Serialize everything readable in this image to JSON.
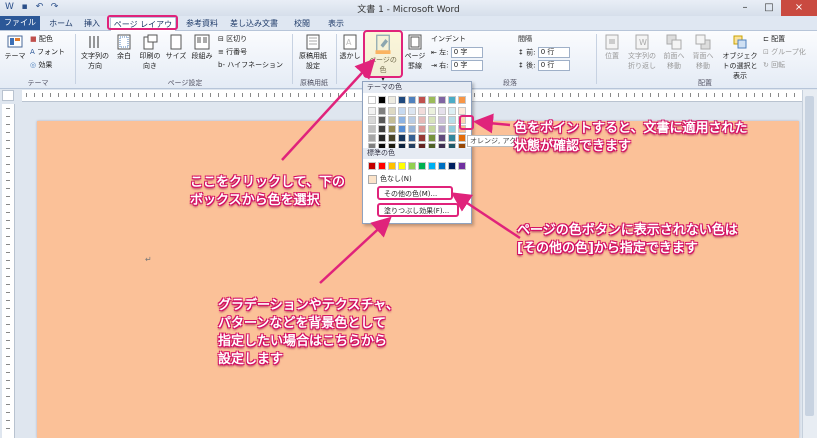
{
  "window": {
    "title": "文書 1 - Microsoft Word"
  },
  "tabs": [
    "ファイル",
    "ホーム",
    "挿入",
    "ページ レイアウト",
    "参考資料",
    "差し込み文書",
    "校閲",
    "表示"
  ],
  "ribbon": {
    "theme": "テーマ",
    "colors": "配色",
    "fonts": "フォント",
    "effects": "効果",
    "text_direction": "文字列の方向",
    "margins": "余白",
    "orientation": "印刷の向き",
    "size": "サイズ",
    "columns": "段組み",
    "breaks": "区切り",
    "line_numbers": "行番号",
    "hyphenation": "ハイフネーション",
    "manuscript": "原稿用紙設定",
    "watermark": "透かし",
    "page_color": "ページの色",
    "page_borders": "ページ罫線",
    "indent_label": "インデント",
    "indent_left_label": "左:",
    "indent_right_label": "右:",
    "indent_left_value": "0 字",
    "indent_right_value": "0 字",
    "spacing_label": "間隔",
    "spacing_before_label": "前:",
    "spacing_after_label": "後:",
    "spacing_before_value": "0 行",
    "spacing_after_value": "0 行",
    "position": "位置",
    "wrap": "文字列の折り返し",
    "bring_forward": "前面へ移動",
    "send_backward": "背面へ移動",
    "selection_pane": "オブジェクトの選択と表示",
    "align": "配置",
    "group": "グループ化",
    "rotate": "回転",
    "groups": {
      "theme": "テーマ",
      "page_setup": "ページ設定",
      "manuscript": "原稿用紙",
      "paragraph": "段落",
      "arrange": "配置"
    }
  },
  "dropdown": {
    "theme_colors_label": "テーマの色",
    "standard_colors_label": "標準の色",
    "no_color": "色なし(N)",
    "more_colors": "その他の色(M)...",
    "fill_effects": "塗りつぶし効果(F)...",
    "tooltip": "オレンジ, アク",
    "theme_colors_top": [
      "#ffffff",
      "#000000",
      "#eeece1",
      "#1f497d",
      "#4f81bd",
      "#c0504d",
      "#9bbb59",
      "#8064a2",
      "#4bacc6",
      "#f79646"
    ],
    "theme_shades": [
      [
        "#f2f2f2",
        "#7f7f7f",
        "#ddd9c3",
        "#c6d9f0",
        "#dbe5f1",
        "#f2dcdb",
        "#ebf1dd",
        "#e5e0ec",
        "#dbeef3",
        "#fdeada"
      ],
      [
        "#d8d8d8",
        "#595959",
        "#c4bd97",
        "#8db3e2",
        "#b8cce4",
        "#e5b9b7",
        "#d7e3bc",
        "#ccc1d9",
        "#b7dde8",
        "#fbd5b5"
      ],
      [
        "#bfbfbf",
        "#3f3f3f",
        "#938953",
        "#548dd4",
        "#95b3d7",
        "#d99694",
        "#c3d69b",
        "#b2a2c7",
        "#92cddc",
        "#fac08f"
      ],
      [
        "#a5a5a5",
        "#262626",
        "#494429",
        "#17365d",
        "#366092",
        "#953734",
        "#76923c",
        "#5f497a",
        "#31859b",
        "#e36c09"
      ],
      [
        "#7f7f7f",
        "#0c0c0c",
        "#1d1b10",
        "#0f243e",
        "#244061",
        "#632423",
        "#4f6128",
        "#3f3151",
        "#205867",
        "#974806"
      ]
    ],
    "standard_colors": [
      "#c00000",
      "#ff0000",
      "#ffc000",
      "#ffff00",
      "#92d050",
      "#00b050",
      "#00b0f0",
      "#0070c0",
      "#002060",
      "#7030a0"
    ]
  },
  "annotations": {
    "a1": [
      "ここをクリックして、下の",
      "ボックスから色を選択"
    ],
    "a2": [
      "色をポイントすると、文書に適用された",
      "状態が確認できます"
    ],
    "a3": [
      "ページの色ボタンに表示されない色は",
      "[その他の色]から指定できます"
    ],
    "a4": [
      "グラデーションやテクスチャ、",
      "パターンなどを背景色として",
      "指定したい場合はこちらから",
      "設定します"
    ]
  },
  "colors": {
    "page": "#fbc198",
    "highlight": "#e0237b",
    "file_tab": "#2b5797"
  }
}
